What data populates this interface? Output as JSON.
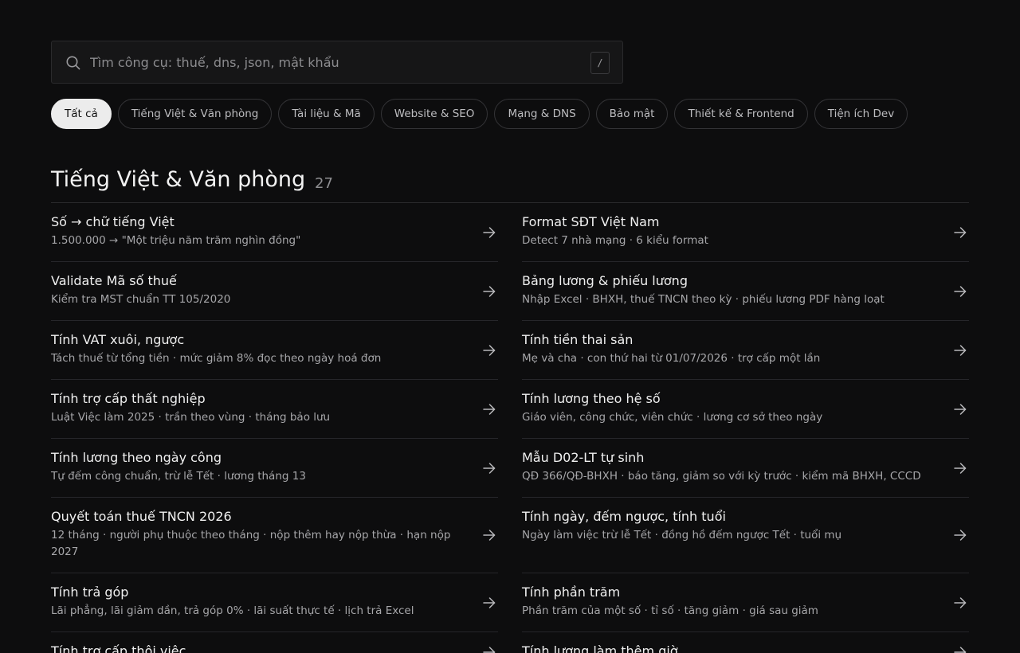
{
  "search": {
    "placeholder": "Tìm công cụ: thuế, dns, json, mật khẩu",
    "shortcut": "/"
  },
  "filters": [
    {
      "label": "Tất cả",
      "active": true
    },
    {
      "label": "Tiếng Việt & Văn phòng",
      "active": false
    },
    {
      "label": "Tài liệu & Mã",
      "active": false
    },
    {
      "label": "Website & SEO",
      "active": false
    },
    {
      "label": "Mạng & DNS",
      "active": false
    },
    {
      "label": "Bảo mật",
      "active": false
    },
    {
      "label": "Thiết kế & Frontend",
      "active": false
    },
    {
      "label": "Tiện ích Dev",
      "active": false
    }
  ],
  "section": {
    "title": "Tiếng Việt & Văn phòng",
    "count": "27"
  },
  "tools": [
    {
      "title": "Số → chữ tiếng Việt",
      "desc": "1.500.000 → \"Một triệu năm trăm nghìn đồng\""
    },
    {
      "title": "Format SĐT Việt Nam",
      "desc": "Detect 7 nhà mạng · 6 kiểu format"
    },
    {
      "title": "Validate Mã số thuế",
      "desc": "Kiểm tra MST chuẩn TT 105/2020"
    },
    {
      "title": "Bảng lương & phiếu lương",
      "desc": "Nhập Excel · BHXH, thuế TNCN theo kỳ · phiếu lương PDF hàng loạt"
    },
    {
      "title": "Tính VAT xuôi, ngược",
      "desc": "Tách thuế từ tổng tiền · mức giảm 8% đọc theo ngày hoá đơn"
    },
    {
      "title": "Tính tiền thai sản",
      "desc": "Mẹ và cha · con thứ hai từ 01/07/2026 · trợ cấp một lần"
    },
    {
      "title": "Tính trợ cấp thất nghiệp",
      "desc": "Luật Việc làm 2025 · trần theo vùng · tháng bảo lưu"
    },
    {
      "title": "Tính lương theo hệ số",
      "desc": "Giáo viên, công chức, viên chức · lương cơ sở theo ngày"
    },
    {
      "title": "Tính lương theo ngày công",
      "desc": "Tự đếm công chuẩn, trừ lễ Tết · lương tháng 13"
    },
    {
      "title": "Mẫu D02-LT tự sinh",
      "desc": "QĐ 366/QĐ-BHXH · báo tăng, giảm so với kỳ trước · kiểm mã BHXH, CCCD"
    },
    {
      "title": "Quyết toán thuế TNCN 2026",
      "desc": "12 tháng · người phụ thuộc theo tháng · nộp thêm hay nộp thừa · hạn nộp 2027"
    },
    {
      "title": "Tính ngày, đếm ngược, tính tuổi",
      "desc": "Ngày làm việc trừ lễ Tết · đồng hồ đếm ngược Tết · tuổi mụ"
    },
    {
      "title": "Tính trả góp",
      "desc": "Lãi phẳng, lãi giảm dần, trả góp 0% · lãi suất thực tế · lịch trả Excel"
    },
    {
      "title": "Tính phần trăm",
      "desc": "Phần trăm của một số · tỉ số · tăng giảm · giá sau giảm"
    },
    {
      "title": "Tính trợ cấp thôi việc",
      "desc": ""
    },
    {
      "title": "Tính lương làm thêm giờ",
      "desc": ""
    }
  ]
}
